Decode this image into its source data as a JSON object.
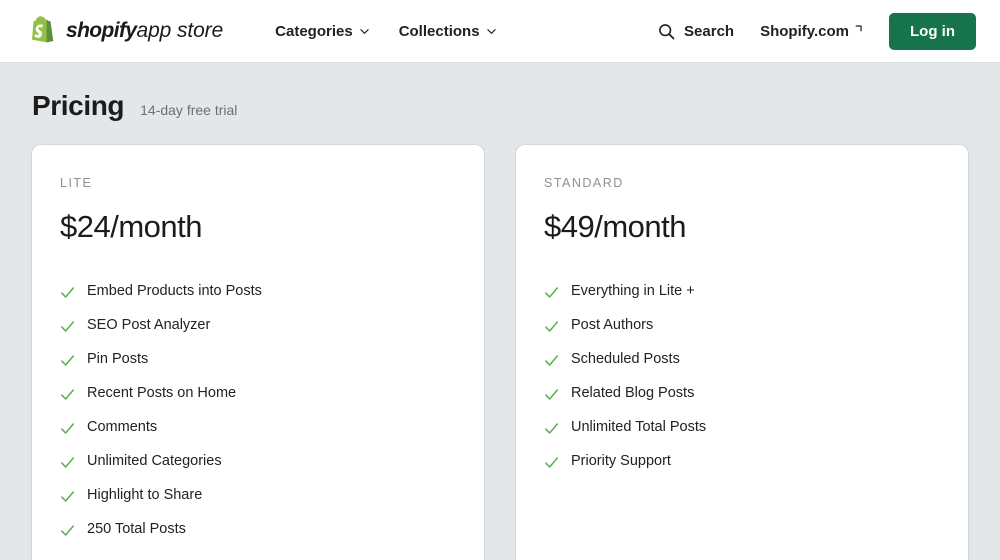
{
  "header": {
    "brand": {
      "logo_icon": "shopify-bag-logo",
      "name_bold": "shopify",
      "name_light": "app store"
    },
    "nav": [
      {
        "label": "Categories",
        "icon": "chevron-down-icon"
      },
      {
        "label": "Collections",
        "icon": "chevron-down-icon"
      }
    ],
    "search": {
      "label": "Search",
      "icon": "search-icon"
    },
    "shopify_com": {
      "label": "Shopify.com",
      "icon": "external-arrow-icon"
    },
    "login": {
      "label": "Log in"
    },
    "colors": {
      "brand_green": "#16734b",
      "text": "#202223"
    }
  },
  "page": {
    "title": "Pricing",
    "subtitle": "14-day free trial"
  },
  "plans": [
    {
      "name": "LITE",
      "price": "$24/month",
      "features": [
        "Embed Products into Posts",
        "SEO Post Analyzer",
        "Pin Posts",
        "Recent Posts on Home",
        "Comments",
        "Unlimited Categories",
        "Highlight to Share",
        "250 Total Posts"
      ]
    },
    {
      "name": "STANDARD",
      "price": "$49/month",
      "features": [
        "Everything in Lite +",
        "Post Authors",
        "Scheduled Posts",
        "Related Blog Posts",
        "Unlimited Total Posts",
        "Priority Support"
      ]
    }
  ],
  "icons": {
    "check": "check-icon"
  },
  "colors": {
    "check_green": "#5aad51",
    "page_bg": "#e4e7e9",
    "card_bg": "#ffffff"
  }
}
